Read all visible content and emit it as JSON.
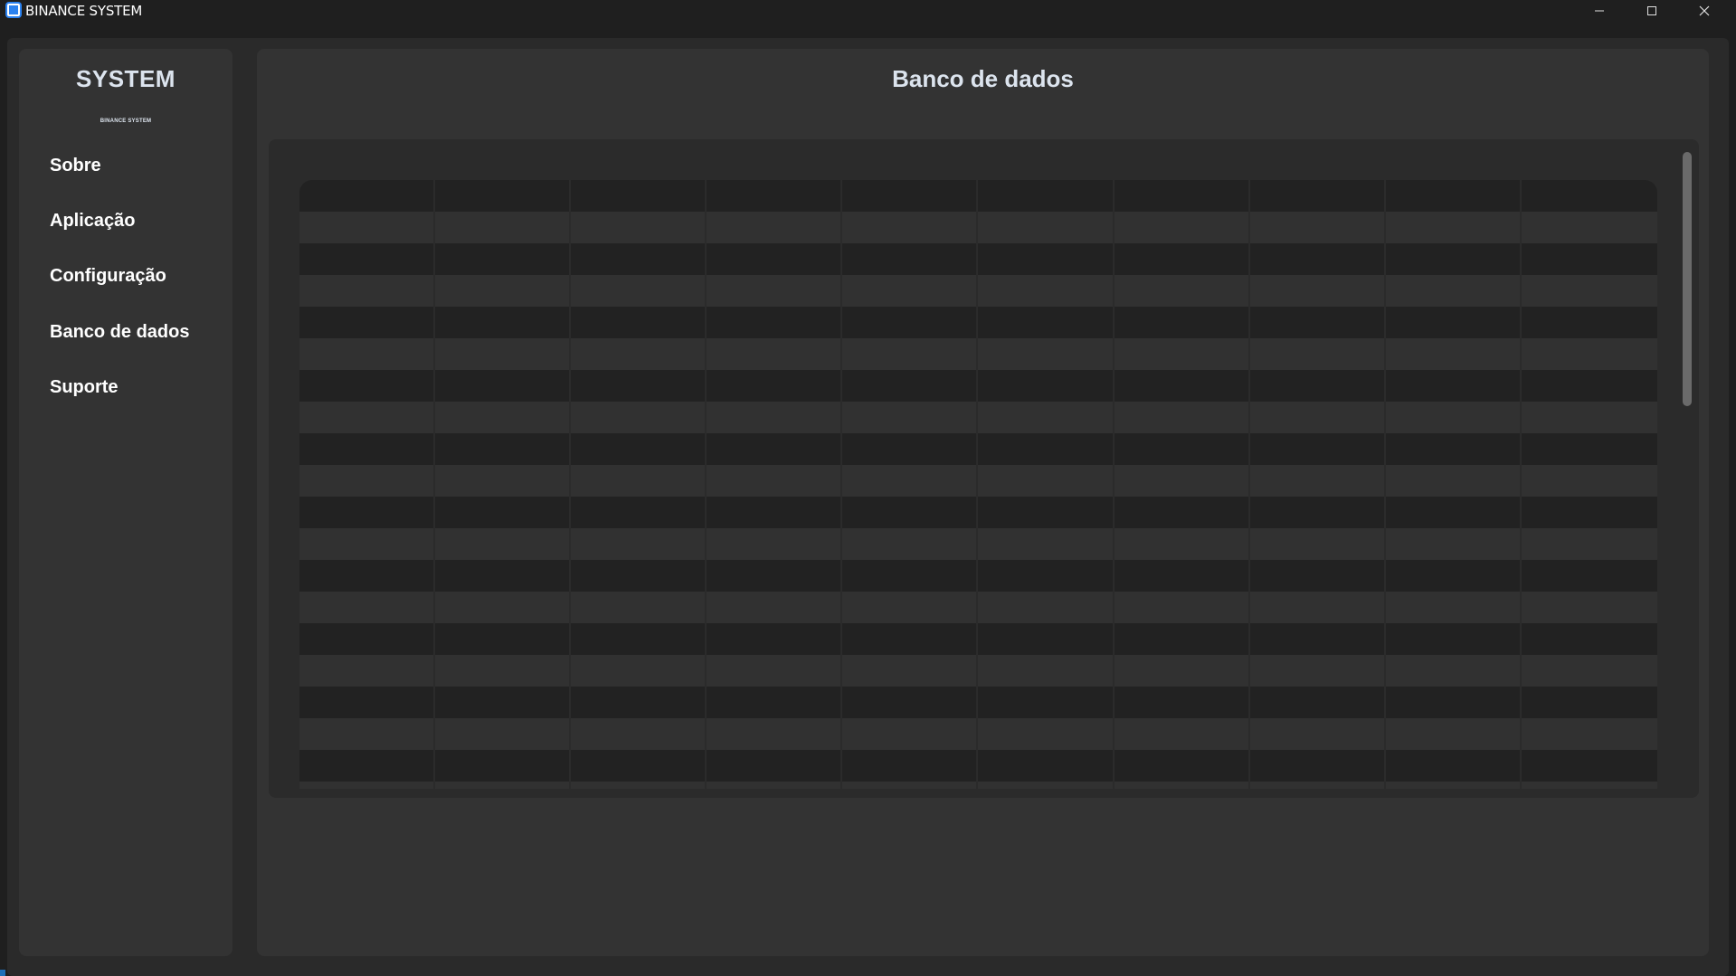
{
  "window": {
    "title": "BINANCE SYSTEM",
    "controls": [
      "minimize-icon",
      "maximize-icon",
      "close-icon"
    ]
  },
  "sidebar": {
    "title": "SYSTEM",
    "subtitle": "BINANCE SYSTEM",
    "items": [
      {
        "label": "Sobre"
      },
      {
        "label": "Aplicação"
      },
      {
        "label": "Configuração"
      },
      {
        "label": "Banco de dados"
      },
      {
        "label": "Suporte"
      }
    ]
  },
  "main": {
    "title": "Banco de dados",
    "table": {
      "columns": 10,
      "rows": 20,
      "row_colors": [
        "#222222",
        "#313131"
      ]
    }
  },
  "colors": {
    "app_background": "#1f1f1f",
    "panel": "#333333",
    "text": "#dce4ee",
    "accent": "#2b82f0"
  }
}
